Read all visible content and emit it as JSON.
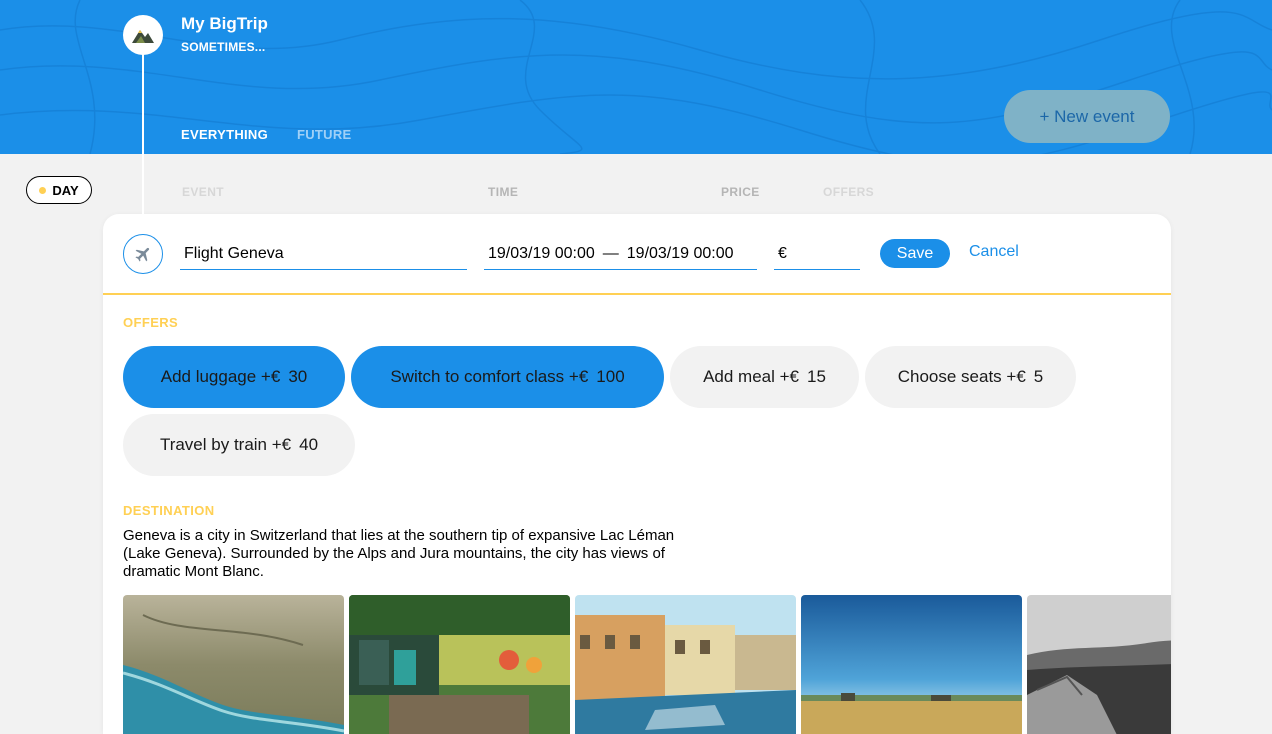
{
  "header": {
    "title": "My BigTrip",
    "subtitle": "SOMETIMES...",
    "tabs": [
      "EVERYTHING",
      "FUTURE"
    ],
    "new_event_label": "+ New event",
    "logo_icon": "mountain-logo-icon",
    "accent_color": "#1b8fe8"
  },
  "day_badge": {
    "label": "DAY",
    "dot_color": "#ffd054"
  },
  "columns": {
    "event": "EVENT",
    "time": "TIME",
    "price": "PRICE",
    "offers": "OFFERS"
  },
  "editor": {
    "type_icon": "airplane-icon",
    "destination_value": "Flight Geneva",
    "time_start": "19/03/19 00:00",
    "time_separator": "—",
    "time_end": "19/03/19 00:00",
    "currency": "€",
    "price_value": "",
    "save_label": "Save",
    "cancel_label": "Cancel"
  },
  "offers": {
    "title": "OFFERS",
    "items": [
      {
        "label": "Add luggage +€",
        "price": "30",
        "selected": true
      },
      {
        "label": "Switch to comfort class +€",
        "price": "100",
        "selected": true
      },
      {
        "label": "Add meal +€",
        "price": "15",
        "selected": false
      },
      {
        "label": "Choose seats +€",
        "price": "5",
        "selected": false
      },
      {
        "label": "Travel by train +€",
        "price": "40",
        "selected": false
      }
    ]
  },
  "destination": {
    "title": "DESTINATION",
    "description": "Geneva is a city in Switzerland that lies at the southern tip of expansive Lac Léman (Lake Geneva). Surrounded by the Alps and Jura mountains, the city has views of dramatic Mont Blanc.",
    "photos": [
      "coastline-photo",
      "cafe-photo",
      "canal-town-photo",
      "field-sky-photo",
      "mountain-landscape-photo"
    ]
  }
}
